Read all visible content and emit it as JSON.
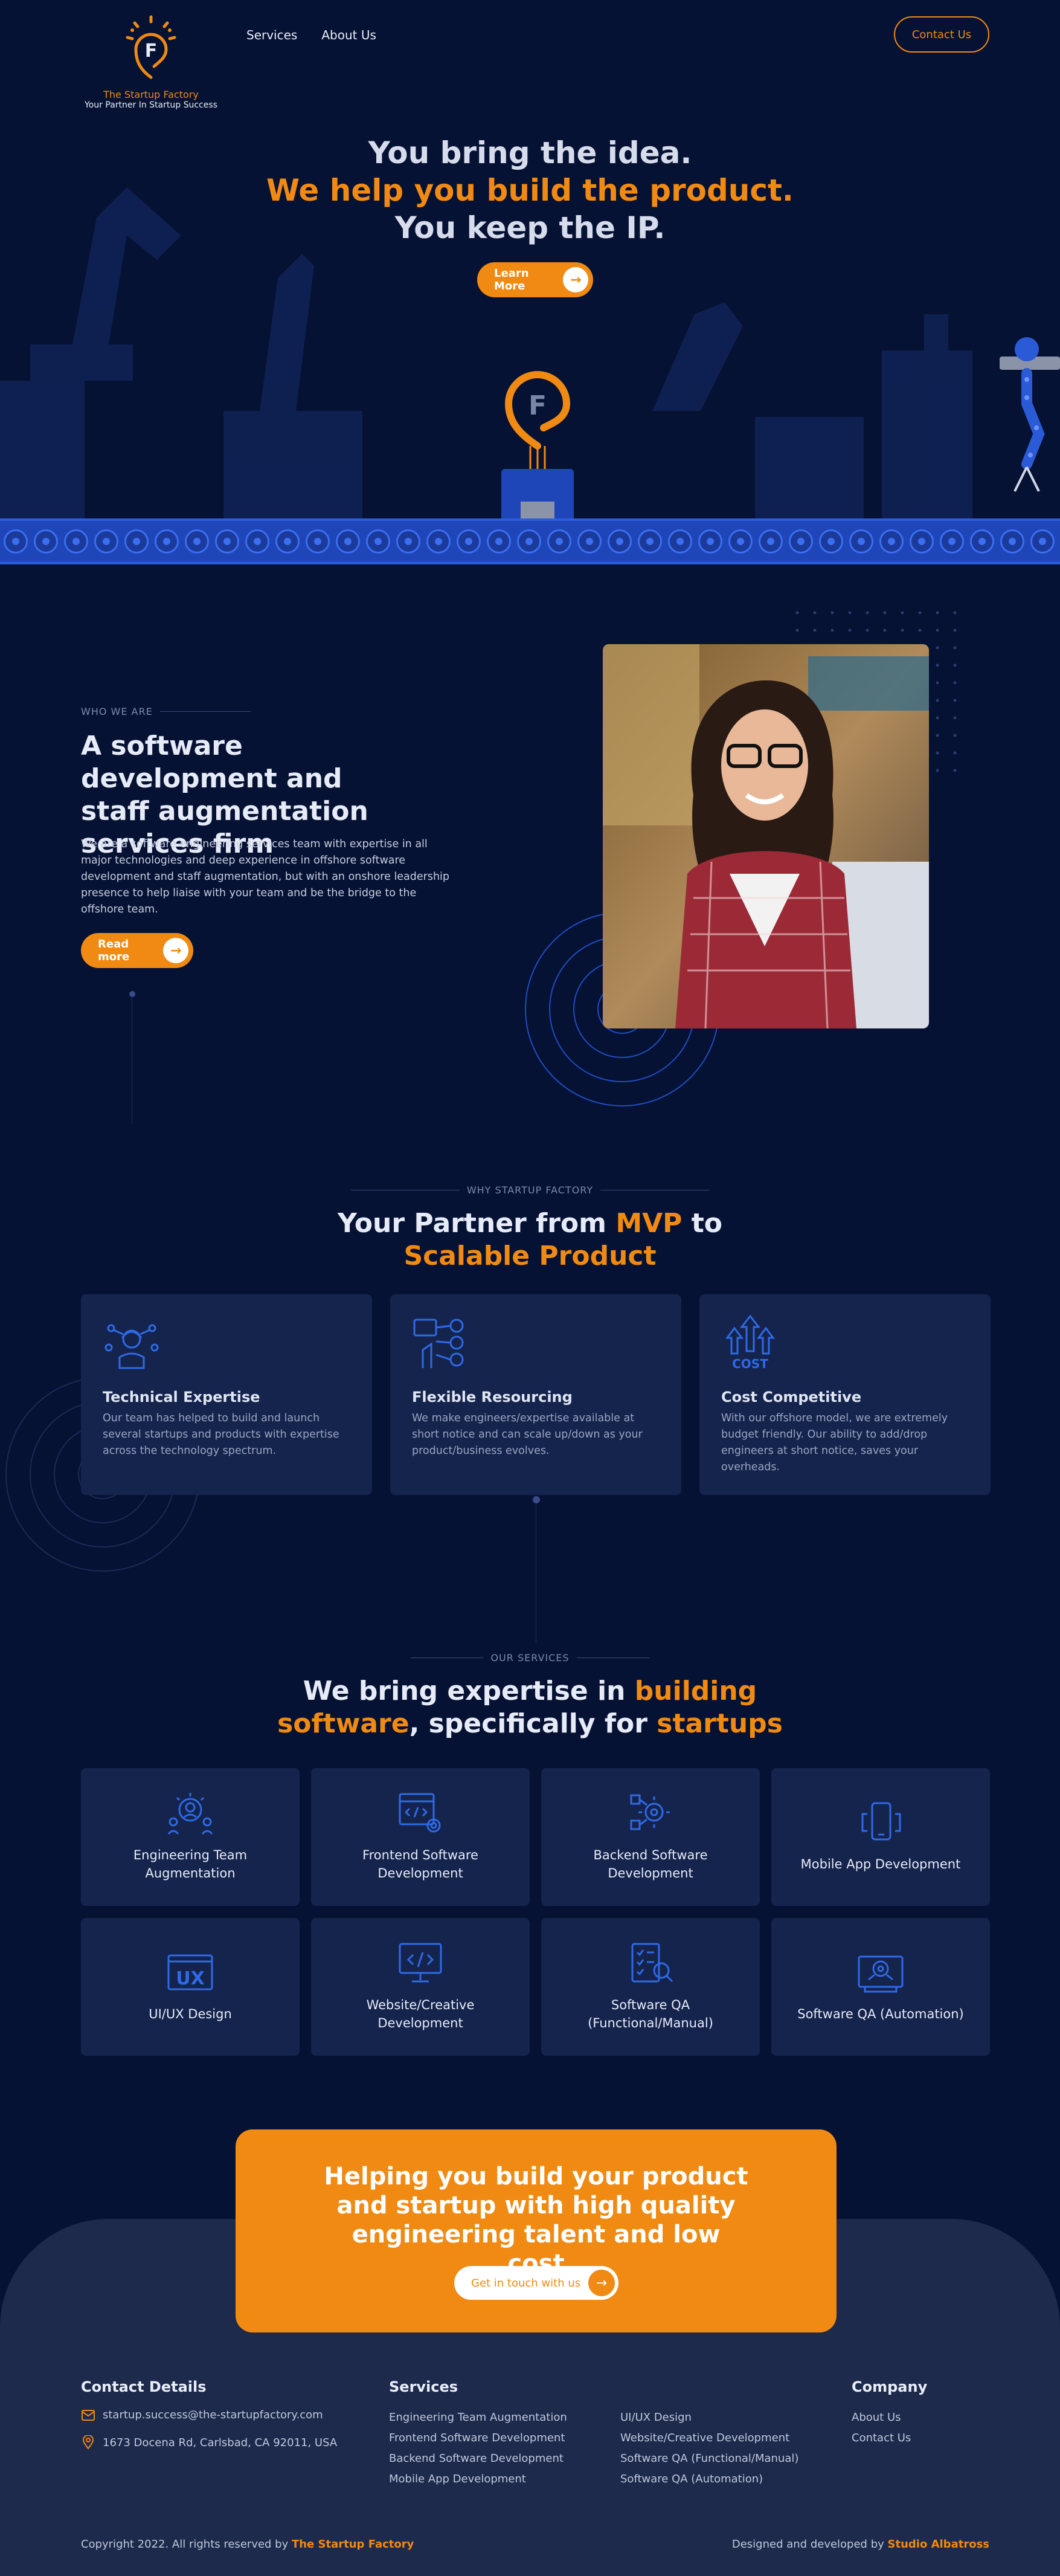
{
  "colors": {
    "background": "#061233",
    "accent": "#f08a12",
    "card": "#15244d",
    "footer": "#1d2a4c",
    "conveyor": "#1e46b8"
  },
  "header": {
    "logo_name": "The Startup Factory",
    "logo_tagline": "Your Partner In Startup Success",
    "nav": [
      "Services",
      "About Us"
    ],
    "contact_button": "Contact Us"
  },
  "hero": {
    "line1": "You bring the idea.",
    "line2": "We help you build the product.",
    "line3": "You keep the IP.",
    "button": "Learn More"
  },
  "who": {
    "eyebrow": "WHO WE ARE",
    "title": "A software development and staff augmentation services firm",
    "text": "We are a software engineering services team with expertise in all major technologies and deep experience in offshore software development and staff augmentation, but with an onshore leadership presence to help liaise with your team and be the bridge to the offshore team.",
    "button": "Read more"
  },
  "why": {
    "eyebrow": "WHY STARTUP FACTORY",
    "title_a": "Your Partner from ",
    "title_b": "MVP",
    "title_c": " to",
    "title_d": "Scalable Product",
    "cards": [
      {
        "icon": "engineer-icon",
        "title": "Technical Expertise",
        "text": "Our team has helped to build and launch several startups and products with expertise across the technology spectrum."
      },
      {
        "icon": "team-resourcing-icon",
        "title": "Flexible Resourcing",
        "text": "We make engineers/expertise available at short notice and can scale up/down as your product/business evolves."
      },
      {
        "icon": "cost-arrows-icon",
        "icon_text": "COST",
        "title": "Cost Competitive",
        "text": "With our offshore model, we are extremely budget friendly. Our ability to add/drop engineers at short notice, saves your overheads."
      }
    ]
  },
  "services": {
    "eyebrow": "OUR SERVICES",
    "title_a": "We bring expertise in ",
    "title_b": "building",
    "title_c": "software",
    "title_d": ", specifically for ",
    "title_e": "startups",
    "items": [
      {
        "icon": "engineering-team-icon",
        "label": "Engineering Team Augmentation"
      },
      {
        "icon": "frontend-code-icon",
        "label": "Frontend Software Development"
      },
      {
        "icon": "backend-gear-icon",
        "label": "Backend Software Development"
      },
      {
        "icon": "mobile-app-icon",
        "label": "Mobile App Development"
      },
      {
        "icon": "ux-icon",
        "icon_text": "UX",
        "label": "UI/UX Design"
      },
      {
        "icon": "website-code-icon",
        "label": "Website/Creative Development"
      },
      {
        "icon": "qa-checklist-icon",
        "label": "Software QA (Functional/Manual)"
      },
      {
        "icon": "qa-automation-icon",
        "label": "Software QA (Automation)"
      }
    ]
  },
  "cta": {
    "title": "Helping you build your product and startup with high quality engineering talent and low cost",
    "button": "Get in touch with us"
  },
  "footer": {
    "contact_heading": "Contact Details",
    "email": "startup.success@the-startupfactory.com",
    "address": "1673 Docena Rd, Carlsbad, CA 92011, USA",
    "services_heading": "Services",
    "services_col1": [
      "Engineering Team Augmentation",
      "Frontend Software Development",
      "Backend Software Development",
      "Mobile App Development"
    ],
    "services_col2": [
      "UI/UX Design",
      "Website/Creative Development",
      "Software QA (Functional/Manual)",
      "Software QA (Automation)"
    ],
    "company_heading": "Company",
    "company_links": [
      "About Us",
      "Contact Us"
    ],
    "copyright_prefix": "Copyright 2022. All rights reserved by ",
    "copyright_brand": "The Startup Factory",
    "credit_prefix": "Designed and developed by ",
    "credit_brand": "Studio Albatross"
  }
}
